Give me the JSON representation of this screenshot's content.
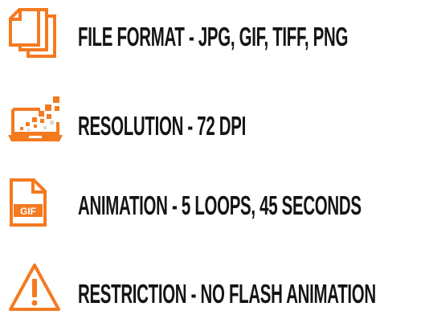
{
  "accent_color": "#f47a20",
  "text_color": "#141414",
  "specs": [
    {
      "icon": "files-icon",
      "label": "FILE FORMAT - JPG, GIF, TIFF, PNG"
    },
    {
      "icon": "laptop-pixels-icon",
      "label": "RESOLUTION - 72 DPI"
    },
    {
      "icon": "gif-file-icon",
      "label": "ANIMATION - 5 LOOPS, 45 SECONDS",
      "icon_text": "GIF"
    },
    {
      "icon": "warning-icon",
      "label": "RESTRICTION - NO FLASH ANIMATION"
    }
  ]
}
